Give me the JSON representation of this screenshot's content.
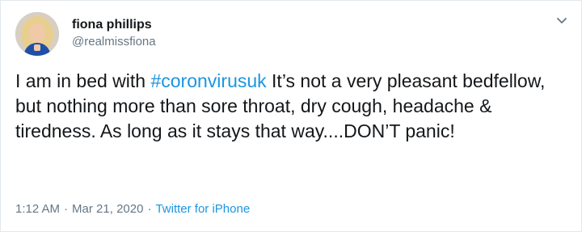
{
  "author": {
    "display_name": "fiona phillips",
    "handle": "@realmissfiona"
  },
  "tweet": {
    "text_before": "I am in bed with ",
    "hashtag": "#coronvirusuk",
    "text_after": " It’s not a very pleasant bedfellow, but nothing more than sore throat, dry cough, headache & tiredness. As long as it stays that way....DON’T panic!"
  },
  "meta": {
    "time": "1:12 AM",
    "separator": "·",
    "date": "Mar 21, 2020",
    "source": "Twitter for iPhone"
  },
  "icons": {
    "menu": "chevron-down-icon",
    "avatar": "avatar"
  },
  "colors": {
    "link": "#1b95e0",
    "secondary_text": "#657786",
    "primary_text": "#14171a",
    "border": "#e1e8ed"
  }
}
